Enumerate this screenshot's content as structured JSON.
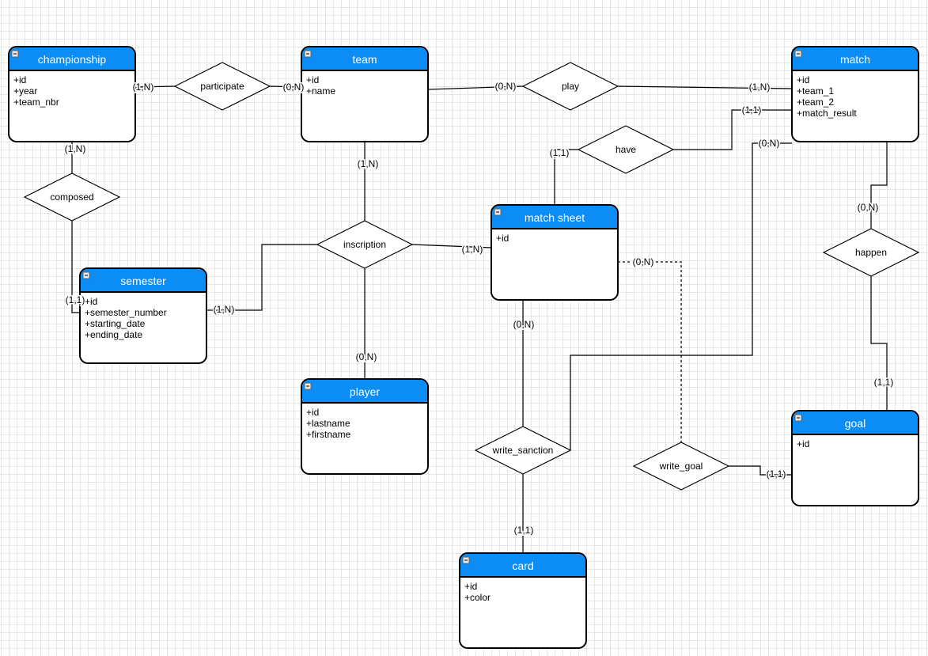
{
  "colors": {
    "header": "#0b8df5",
    "header_text": "#ffffff",
    "stroke": "#000000",
    "label": "#000000"
  },
  "entities": [
    {
      "id": "championship",
      "title": "championship",
      "attributes": [
        "+id",
        "+year",
        "+team_nbr"
      ]
    },
    {
      "id": "team",
      "title": "team",
      "attributes": [
        "+id",
        "+name"
      ]
    },
    {
      "id": "match",
      "title": "match",
      "attributes": [
        "+id",
        "+team_1",
        "+team_2",
        "+match_result"
      ]
    },
    {
      "id": "match-sheet",
      "title": "match sheet",
      "attributes": [
        "+id"
      ]
    },
    {
      "id": "semester",
      "title": "semester",
      "attributes": [
        "+id",
        "+semester_number",
        "+starting_date",
        "+ending_date"
      ]
    },
    {
      "id": "player",
      "title": "player",
      "attributes": [
        "+id",
        "+lastname",
        "+firstname"
      ]
    },
    {
      "id": "goal",
      "title": "goal",
      "attributes": [
        "+id"
      ]
    },
    {
      "id": "card",
      "title": "card",
      "attributes": [
        "+id",
        "+color"
      ]
    }
  ],
  "relationships": [
    {
      "id": "participate",
      "label": "participate"
    },
    {
      "id": "play",
      "label": "play"
    },
    {
      "id": "have",
      "label": "have"
    },
    {
      "id": "composed",
      "label": "composed"
    },
    {
      "id": "inscription",
      "label": "inscription"
    },
    {
      "id": "happen",
      "label": "happen"
    },
    {
      "id": "write-sanction",
      "label": "write_sanction"
    },
    {
      "id": "write-goal",
      "label": "write_goal"
    }
  ],
  "links": [
    {
      "from": "championship",
      "to": "participate",
      "cardinality": "(1,N)"
    },
    {
      "from": "team",
      "to": "participate",
      "cardinality": "(0,N)"
    },
    {
      "from": "team",
      "to": "play",
      "cardinality": "(0,N)"
    },
    {
      "from": "match",
      "to": "play",
      "cardinality": "(1,N)"
    },
    {
      "from": "match",
      "to": "have",
      "cardinality": "(1,1)"
    },
    {
      "from": "match-sheet",
      "to": "have",
      "cardinality": "(1,1)"
    },
    {
      "from": "championship",
      "to": "composed",
      "cardinality": "(1,N)"
    },
    {
      "from": "semester",
      "to": "composed",
      "cardinality": "(1,1)"
    },
    {
      "from": "team",
      "to": "inscription",
      "cardinality": "(1,N)"
    },
    {
      "from": "semester",
      "to": "inscription",
      "cardinality": "(1,N)"
    },
    {
      "from": "match-sheet",
      "to": "inscription",
      "cardinality": "(1,N)"
    },
    {
      "from": "player",
      "to": "inscription",
      "cardinality": "(0,N)"
    },
    {
      "from": "match-sheet",
      "to": "write-sanction",
      "cardinality": "(0,N)"
    },
    {
      "from": "card",
      "to": "write-sanction",
      "cardinality": "(1,1)"
    },
    {
      "from": "match",
      "to": "write-sanction",
      "cardinality": "(0,N)"
    },
    {
      "from": "match",
      "to": "happen",
      "cardinality": "(0,N)"
    },
    {
      "from": "goal",
      "to": "happen",
      "cardinality": "(1,1)"
    },
    {
      "from": "match-sheet",
      "to": "write-goal",
      "cardinality": "(0,N)",
      "dashed": true
    },
    {
      "from": "goal",
      "to": "write-goal",
      "cardinality": "(1,1)"
    }
  ]
}
